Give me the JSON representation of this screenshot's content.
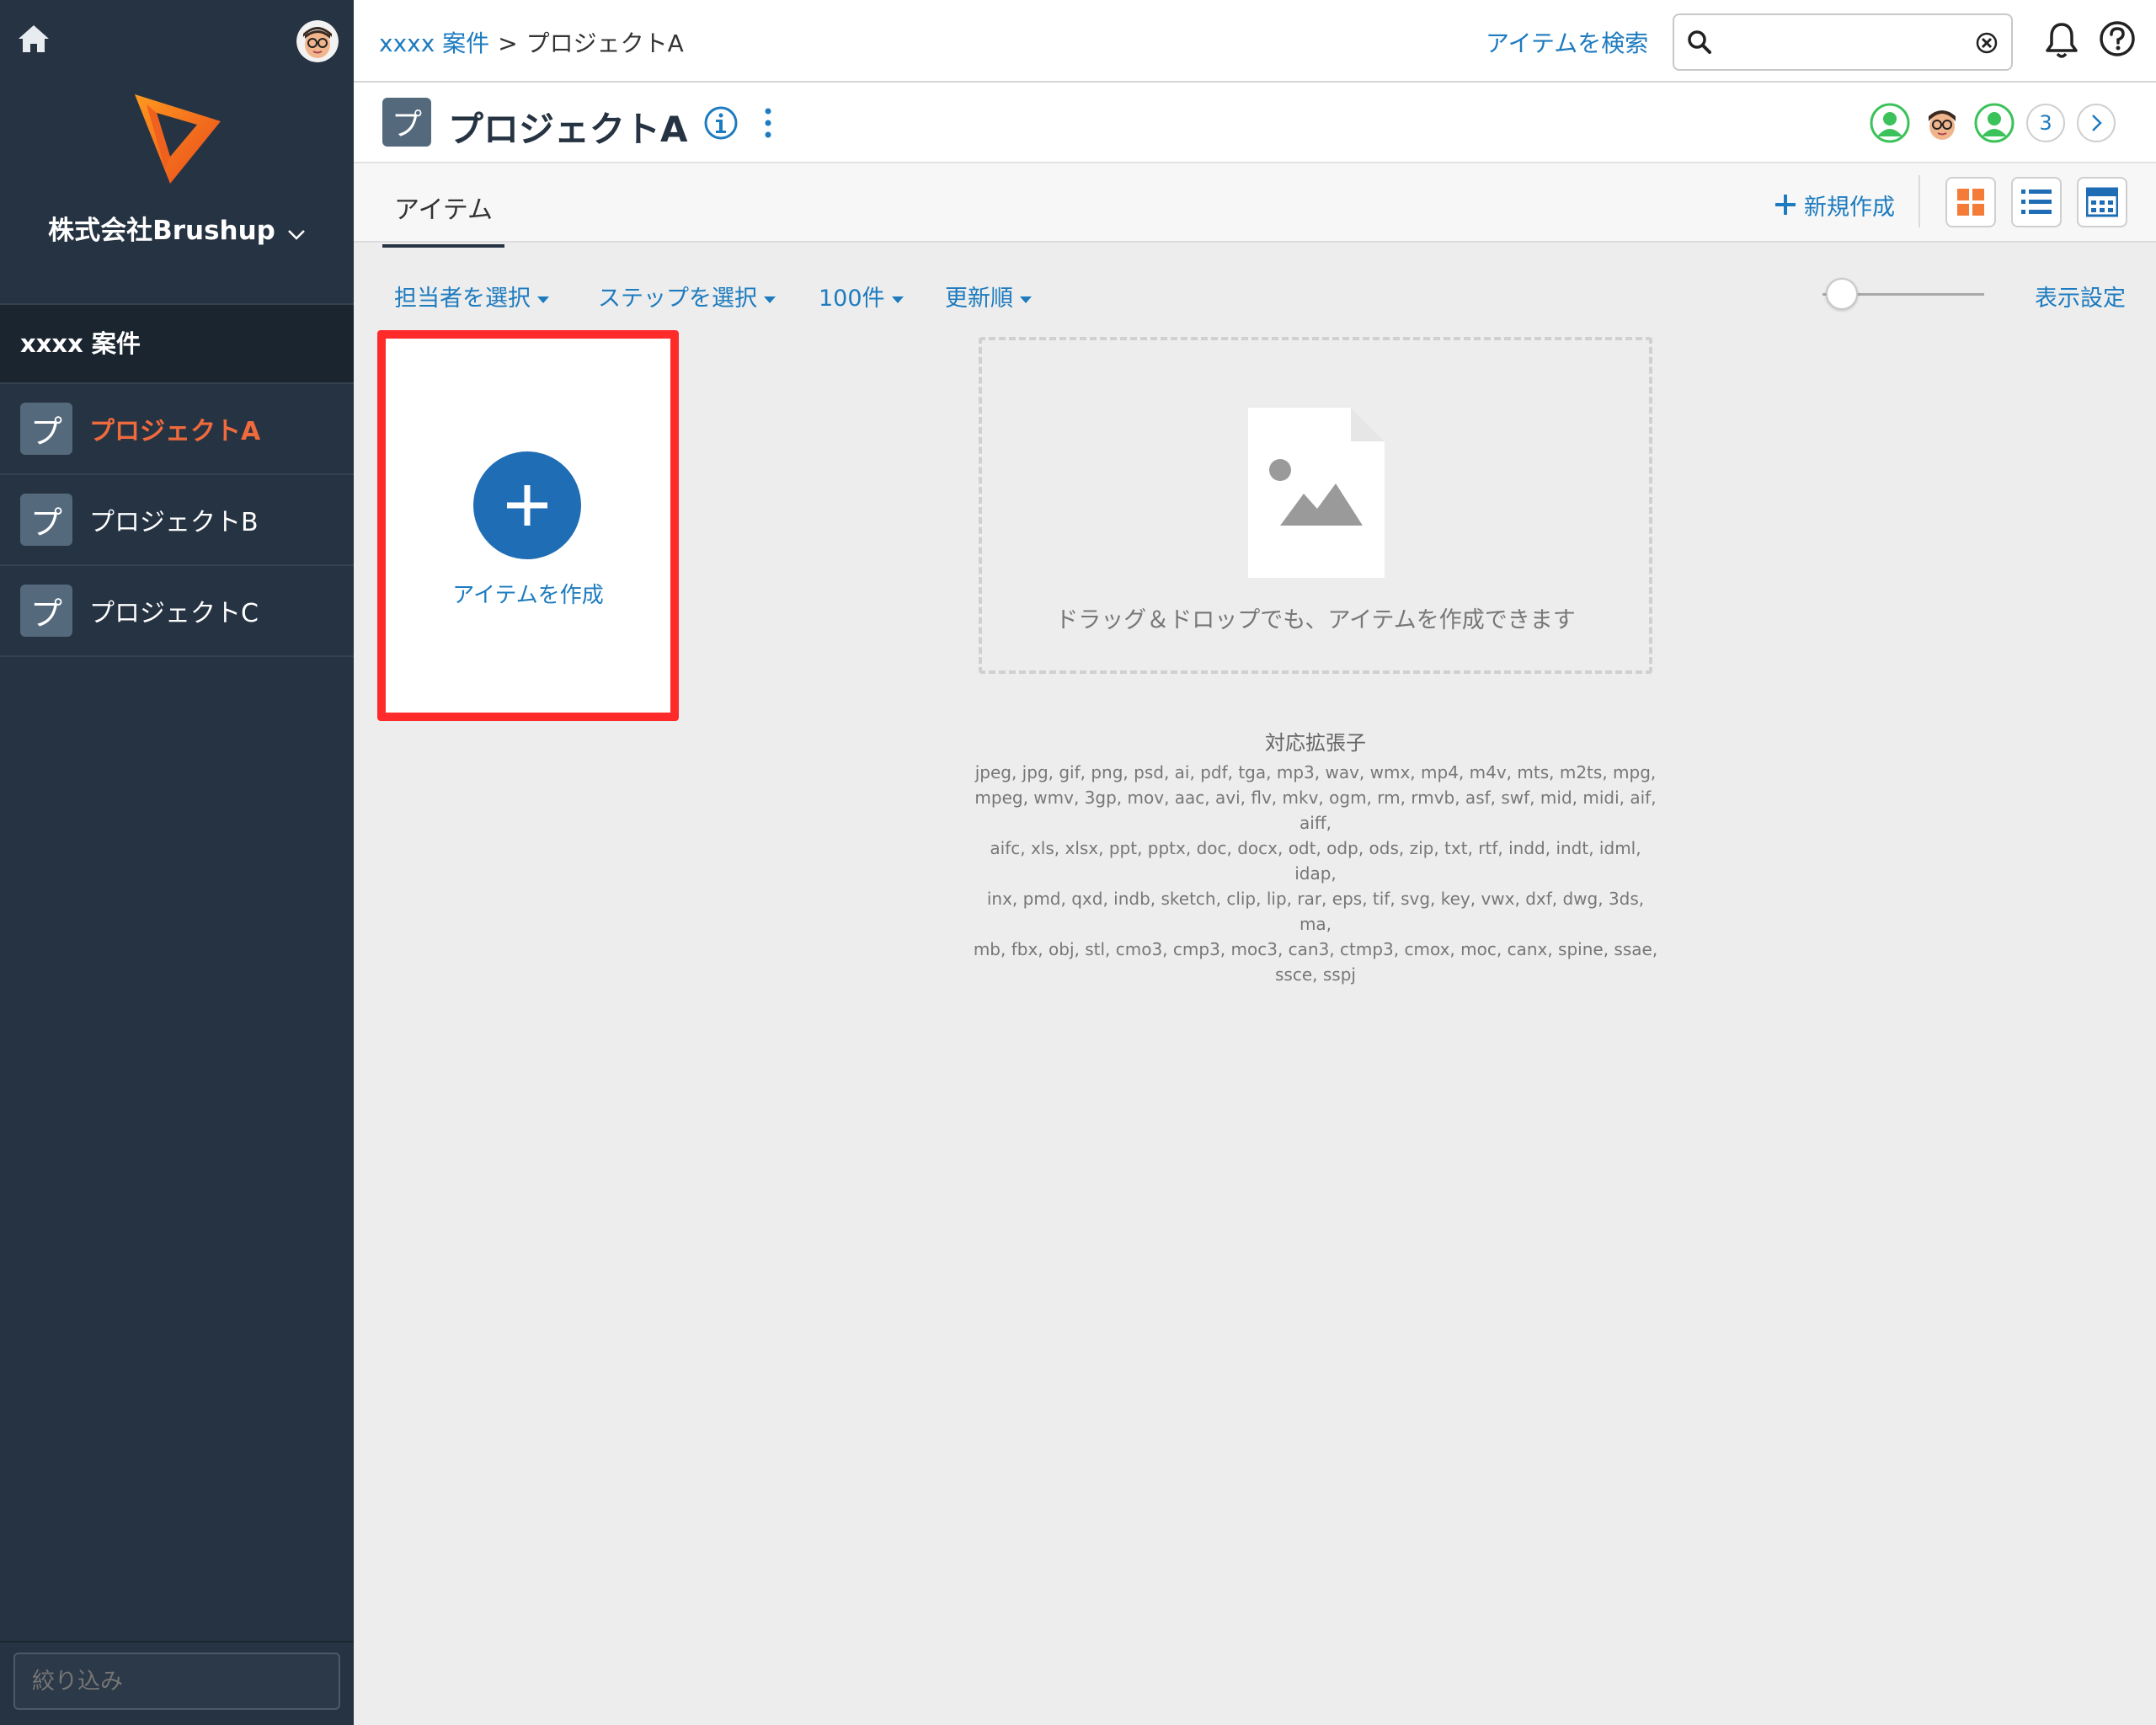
{
  "sidebar": {
    "company_name": "株式会社Brushup",
    "group_title": "xxxx 案件",
    "projects": [
      {
        "icon_char": "プ",
        "label": "プロジェクトA",
        "active": true
      },
      {
        "icon_char": "プ",
        "label": "プロジェクトB",
        "active": false
      },
      {
        "icon_char": "プ",
        "label": "プロジェクトC",
        "active": false
      }
    ],
    "filter_placeholder": "絞り込み",
    "icons": [
      "home-icon",
      "user-avatar",
      "brushup-logo",
      "chevron-down-icon"
    ]
  },
  "topbar": {
    "breadcrumb": {
      "parent": "xxxx 案件",
      "separator": ">",
      "current": "プロジェクトA"
    },
    "search_link": "アイテムを検索",
    "search_value": "",
    "icons": [
      "search-icon",
      "clear-icon",
      "bell-icon",
      "help-icon"
    ]
  },
  "project_header": {
    "icon_char": "プ",
    "title": "プロジェクトA",
    "member_overflow_count": "3",
    "icons": [
      "info-icon",
      "more-vertical-icon",
      "chevron-right-icon"
    ]
  },
  "tabs": {
    "active_tab": "アイテム",
    "new_button_label": "新規作成",
    "view_modes": [
      "grid-view-icon",
      "list-view-icon",
      "calendar-view-icon"
    ]
  },
  "filters": {
    "assignee": "担当者を選択",
    "step": "ステップを選択",
    "count": "100件",
    "sort": "更新順",
    "display_settings": "表示設定",
    "thumbnail_size_level": 0
  },
  "content": {
    "create_label": "アイテムを作成",
    "dropzone_text": "ドラッグ＆ドロップでも、アイテムを作成できます",
    "extensions_title": "対応拡張子",
    "extensions_lines": [
      "jpeg, jpg, gif, png, psd, ai, pdf, tga, mp3, wav, wmx, mp4, m4v, mts, m2ts, mpg,",
      "mpeg, wmv, 3gp, mov, aac, avi, flv, mkv, ogm, rm, rmvb, asf, swf, mid, midi, aif, aiff,",
      "aifc, xls, xlsx, ppt, pptx, doc, docx, odt, odp, ods, zip, txt, rtf, indd, indt, idml, idap,",
      "inx, pmd, qxd, indb, sketch, clip, lip, rar, eps, tif, svg, key, vwx, dxf, dwg, 3ds, ma,",
      "mb, fbx, obj, stl, cmo3, cmp3, moc3, can3, ctmp3, cmox, moc, canx, spine, ssae,",
      "ssce, sspj"
    ]
  },
  "colors": {
    "sidebar_bg": "#263342",
    "accent_blue": "#1d7bbf",
    "active_orange": "#ef6a3c",
    "highlight_red": "#ff2a2a",
    "create_button": "#1f6db5"
  }
}
